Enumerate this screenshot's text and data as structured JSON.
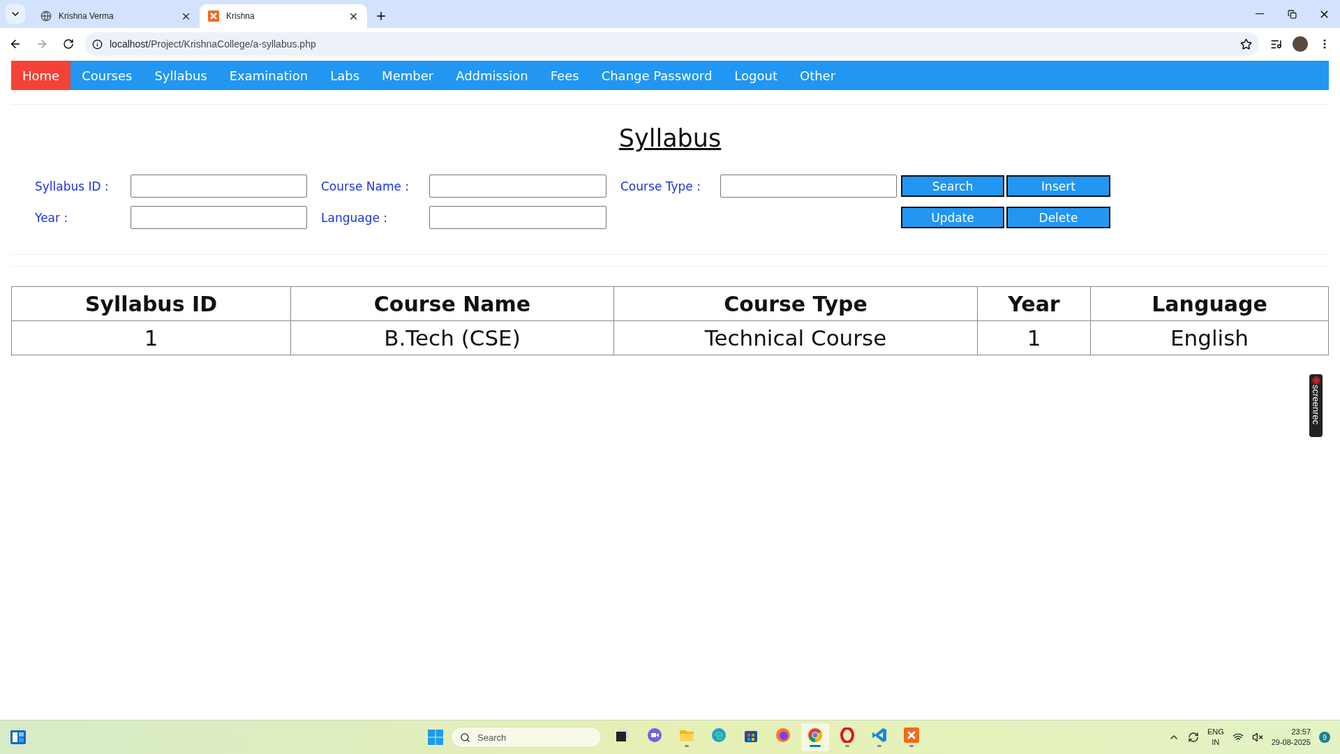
{
  "browser": {
    "tabs": [
      {
        "title": "Krishna Verma",
        "kind": "globe",
        "selected": false
      },
      {
        "title": "Krishna",
        "kind": "xampp",
        "selected": true
      }
    ],
    "url": {
      "host": "localhost",
      "path": "/Project/KrishnaCollege/a-syllabus.php"
    }
  },
  "nav": [
    {
      "label": "Home",
      "selected": true
    },
    {
      "label": "Courses",
      "selected": false
    },
    {
      "label": "Syllabus",
      "selected": false
    },
    {
      "label": "Examination",
      "selected": false
    },
    {
      "label": "Labs",
      "selected": false
    },
    {
      "label": "Member",
      "selected": false
    },
    {
      "label": "Addmission",
      "selected": false
    },
    {
      "label": "Fees",
      "selected": false
    },
    {
      "label": "Change Password",
      "selected": false
    },
    {
      "label": "Logout",
      "selected": false
    },
    {
      "label": "Other",
      "selected": false
    }
  ],
  "page_title": "Syllabus",
  "form": {
    "rows": [
      {
        "fields": [
          {
            "label": "Syllabus ID :"
          },
          {
            "label": "Course Name :"
          },
          {
            "label": "Course Type :"
          }
        ],
        "buttons": [
          "Search",
          "Insert"
        ]
      },
      {
        "fields": [
          {
            "label": "Year :"
          },
          {
            "label": "Language :"
          }
        ],
        "buttons": [
          "Update",
          "Delete"
        ]
      }
    ]
  },
  "table": {
    "columns": [
      "Syllabus ID",
      "Course Name",
      "Course Type",
      "Year",
      "Language"
    ],
    "rows": [
      [
        "1",
        "B.Tech (CSE)",
        "Technical Course",
        "1",
        "English"
      ]
    ]
  },
  "screenrec": {
    "label": "screenrec"
  },
  "taskbar": {
    "search_placeholder": "Search",
    "apps": [
      {
        "kind": "taskview",
        "running": false,
        "selected": false
      },
      {
        "kind": "chat",
        "running": false,
        "selected": false
      },
      {
        "kind": "folder",
        "running": true,
        "selected": false
      },
      {
        "kind": "edge",
        "running": false,
        "selected": false
      },
      {
        "kind": "store",
        "running": false,
        "selected": false
      },
      {
        "kind": "firefox",
        "running": false,
        "selected": false
      },
      {
        "kind": "chrome",
        "running": true,
        "selected": true
      },
      {
        "kind": "opera",
        "running": true,
        "selected": false
      },
      {
        "kind": "vscode",
        "running": true,
        "selected": false
      },
      {
        "kind": "xampp",
        "running": true,
        "selected": false
      }
    ],
    "language": [
      "ENG",
      "IN"
    ],
    "time": "23:57",
    "date": "29-08-2025",
    "notifications": "9"
  }
}
